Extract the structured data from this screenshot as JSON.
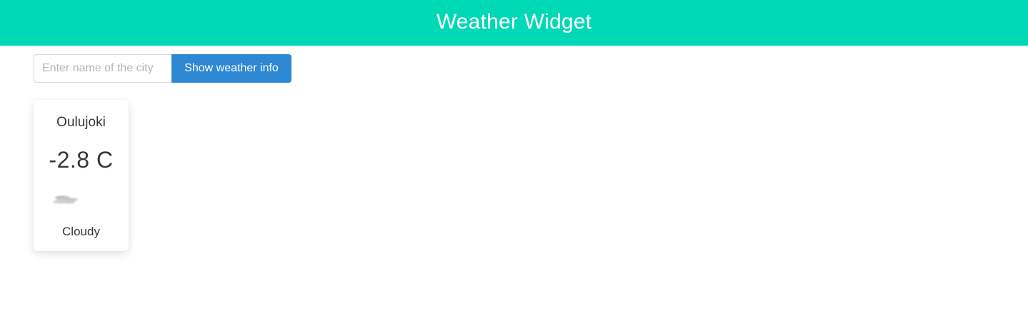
{
  "header": {
    "title": "Weather Widget",
    "background_color": "#00d9b5"
  },
  "search": {
    "placeholder": "Enter name of the city",
    "value": "",
    "button_label": "Show weather info",
    "button_color": "#2e88d4"
  },
  "weather_card": {
    "city": "Oulujoki",
    "temperature": "-2.8 C",
    "icon": "cloudy-icon",
    "condition": "Cloudy"
  }
}
